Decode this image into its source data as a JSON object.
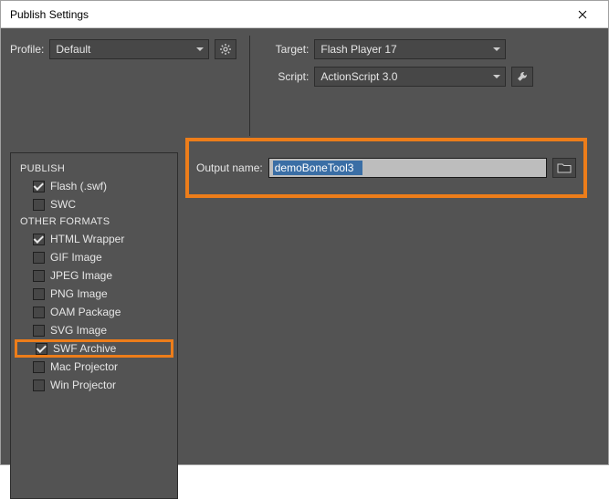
{
  "window": {
    "title": "Publish Settings"
  },
  "profile": {
    "label": "Profile:",
    "value": "Default"
  },
  "target": {
    "label": "Target:",
    "value": "Flash Player 17"
  },
  "script": {
    "label": "Script:",
    "value": "ActionScript 3.0"
  },
  "output": {
    "label": "Output name:",
    "value": "demoBoneTool3"
  },
  "sidebar": {
    "publish_head": "PUBLISH",
    "other_head": "OTHER FORMATS",
    "items": {
      "flash": "Flash (.swf)",
      "swc": "SWC",
      "html": "HTML Wrapper",
      "gif": "GIF Image",
      "jpeg": "JPEG Image",
      "png": "PNG Image",
      "oam": "OAM Package",
      "svg": "SVG Image",
      "swfarchive": "SWF Archive",
      "macproj": "Mac Projector",
      "winproj": "Win Projector"
    }
  }
}
